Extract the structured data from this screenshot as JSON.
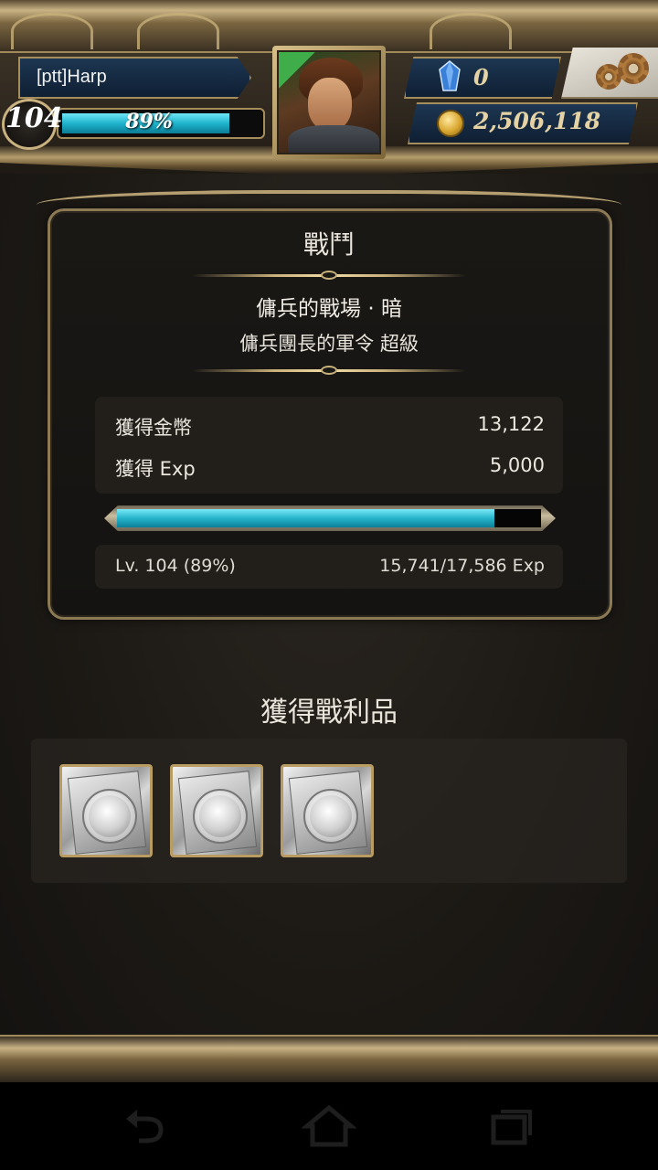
{
  "player": {
    "name": "[ptt]Harp",
    "level": "104",
    "exp_percent_label": "89%",
    "exp_fraction": 0.89
  },
  "currency": {
    "gems": "0",
    "coins": "2,506,118"
  },
  "battle": {
    "title": "戰鬥",
    "stage_name": "傭兵的戰場 · 暗",
    "mission_name": "傭兵團長的軍令 超級",
    "rewards": [
      {
        "label": "獲得金幣",
        "value": "13,122"
      },
      {
        "label": "獲得 Exp",
        "value": "5,000"
      }
    ],
    "exp_bar_fraction": 0.89,
    "level_status": "Lv. 104 (89%)",
    "exp_status": "15,741/17,586 Exp"
  },
  "loot": {
    "title": "獲得戰利品",
    "items": [
      {
        "icon": "silver-coin-card-icon"
      },
      {
        "icon": "silver-coin-card-icon"
      },
      {
        "icon": "silver-coin-card-icon"
      }
    ]
  },
  "navbar": {
    "buttons": [
      "back-icon",
      "home-icon",
      "recent-apps-icon"
    ]
  },
  "colors": {
    "exp_bar": "#26b4cb",
    "gold_trim": "#c8b07a",
    "plate_blue": "#1d3652"
  }
}
